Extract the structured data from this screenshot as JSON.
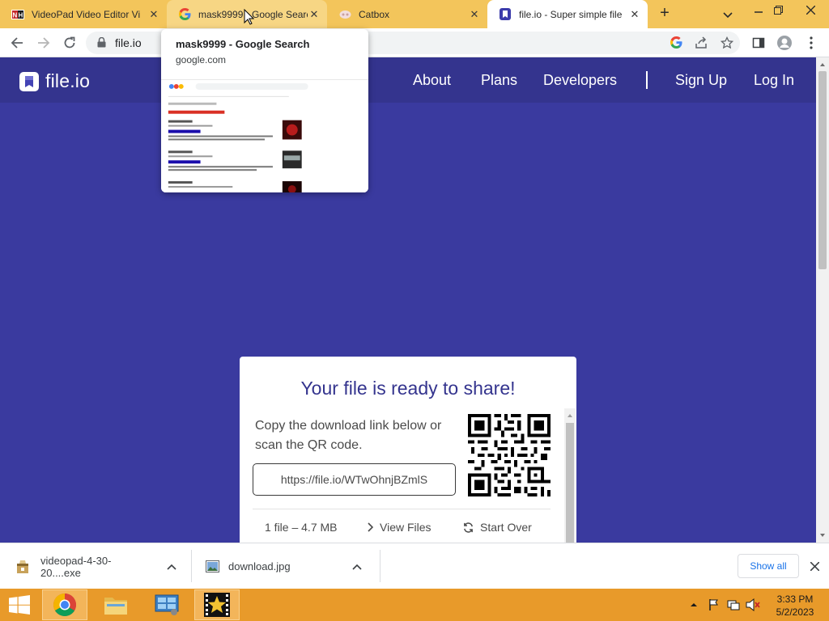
{
  "browser": {
    "tabs": [
      {
        "title": "VideoPad Video Editor Vi",
        "icon": "videopad-icon"
      },
      {
        "title": "mask9999 - Google Search",
        "icon": "google-icon"
      },
      {
        "title": "Catbox",
        "icon": "catbox-icon"
      },
      {
        "title": "file.io - Super simple file",
        "icon": "fileio-icon"
      }
    ],
    "new_tab_label": "+",
    "address": "file.io",
    "hover_card": {
      "title": "mask9999 - Google Search",
      "domain": "google.com"
    }
  },
  "site": {
    "logo_text": "file.io",
    "nav": {
      "about": "About",
      "plans": "Plans",
      "developers": "Developers",
      "signup": "Sign Up",
      "login": "Log In"
    },
    "card": {
      "title": "Your file is ready to share!",
      "copy": "Copy the download link below or scan the QR code.",
      "link": "https://file.io/WTwOhnjBZmlS",
      "file_summary": "1 file – 4.7 MB",
      "view_files": "View Files",
      "start_over": "Start Over"
    }
  },
  "downloads": {
    "items": [
      {
        "name": "videopad-4-30-20....exe",
        "icon": "installer-icon"
      },
      {
        "name": "download.jpg",
        "icon": "image-file-icon"
      }
    ],
    "show_all": "Show all"
  },
  "taskbar": {
    "time": "3:33 PM",
    "date": "5/2/2023",
    "colors": {
      "bar": "#e89a2a"
    }
  },
  "colors": {
    "page_bg": "#3a3a9f",
    "header_bg": "#34348e",
    "tabstrip": "#f3c55b",
    "title_text": "#34348e"
  }
}
